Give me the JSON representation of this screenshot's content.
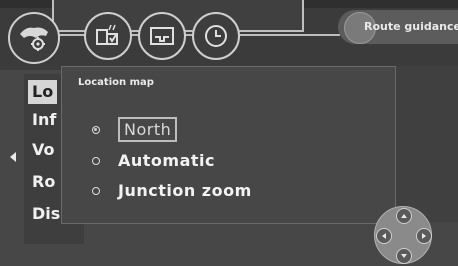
{
  "top_icons": [
    {
      "name": "map-settings-icon"
    },
    {
      "name": "fuel-info-icon"
    },
    {
      "name": "display-panel-icon"
    },
    {
      "name": "clock-icon"
    }
  ],
  "route_guidance": {
    "label": "Route guidance"
  },
  "left_menu": {
    "items": [
      {
        "label": "Lo"
      },
      {
        "label": "Inf"
      },
      {
        "label": "Vo"
      },
      {
        "label": "Ro"
      },
      {
        "label": "Dis"
      }
    ]
  },
  "location_map": {
    "title": "Location map",
    "options": [
      {
        "label": "North",
        "selected": true
      },
      {
        "label": "Automatic",
        "selected": false
      },
      {
        "label": "Junction zoom",
        "selected": false
      }
    ]
  }
}
